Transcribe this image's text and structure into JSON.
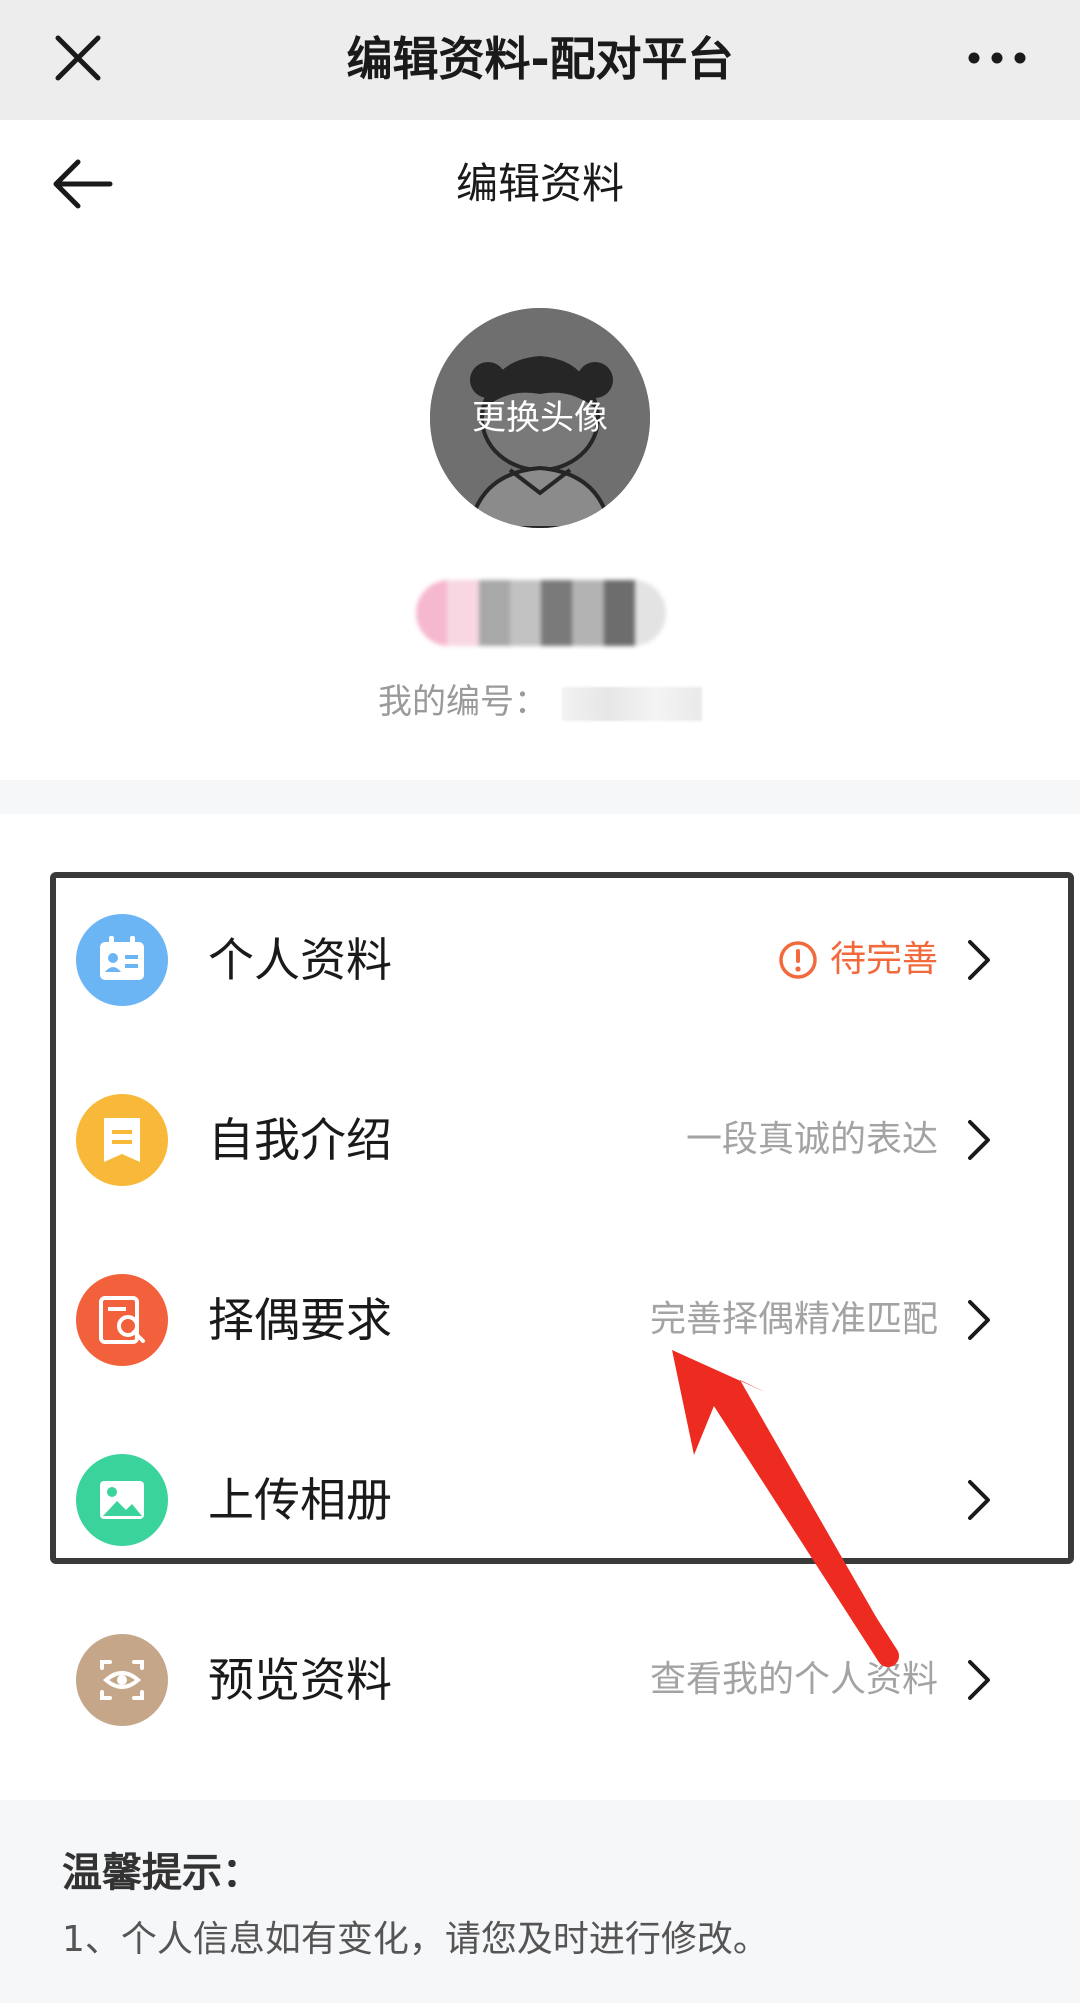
{
  "window": {
    "title": "编辑资料-配对平台",
    "close_icon": "close-icon",
    "more_icon": "more-icon"
  },
  "header": {
    "title": "编辑资料",
    "back_icon": "arrow-left-icon"
  },
  "profile": {
    "avatar_label": "更换头像",
    "id_label": "我的编号："
  },
  "menu": {
    "items": [
      {
        "label": "个人资料",
        "hint": "待完善",
        "icon": "id-card-icon",
        "color": "#6cb5f5",
        "status": "warning"
      },
      {
        "label": "自我介绍",
        "hint": "一段真诚的表达",
        "icon": "bookmark-note-icon",
        "color": "#f8b93a"
      },
      {
        "label": "择偶要求",
        "hint": "完善择偶精准匹配",
        "icon": "search-document-icon",
        "color": "#f2613b"
      },
      {
        "label": "上传相册",
        "hint": "",
        "icon": "image-icon",
        "color": "#3bd39c"
      },
      {
        "label": "预览资料",
        "hint": "查看我的个人资料",
        "icon": "eye-scan-icon",
        "color": "#c6a688"
      }
    ]
  },
  "tips": {
    "title": "温馨提示：",
    "lines": [
      "1、个人信息如有变化，请您及时进行修改。"
    ]
  },
  "colors": {
    "warning": "#f26a3c",
    "annotation_arrow": "#ee2b20",
    "topbar": "#ededed"
  }
}
